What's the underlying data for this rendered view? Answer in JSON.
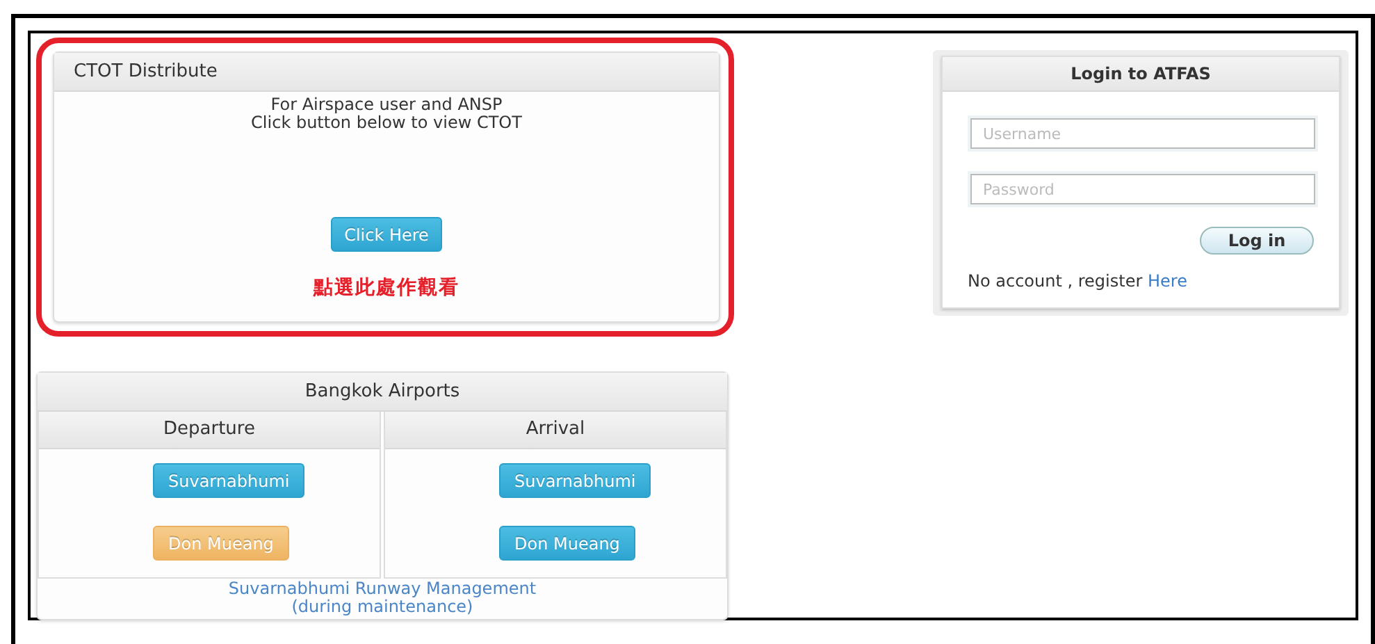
{
  "ctot_panel": {
    "title": "CTOT Distribute",
    "description": [
      "For Airspace user and ANSP",
      "Click button below to view CTOT"
    ],
    "button": "Click Here",
    "note": "點選此處作觀看"
  },
  "airports_panel": {
    "title": "Bangkok Airports",
    "columns": [
      {
        "heading": "Departure",
        "buttons": [
          {
            "label": "Suvarnabhumi",
            "kind": "info"
          },
          {
            "label": "Don Mueang",
            "kind": "warning"
          }
        ]
      },
      {
        "heading": "Arrival",
        "buttons": [
          {
            "label": "Suvarnabhumi",
            "kind": "info"
          },
          {
            "label": "Don Mueang",
            "kind": "info"
          }
        ]
      }
    ],
    "link": [
      "Suvarnabhumi Runway Management",
      "(during maintenance)"
    ]
  },
  "login_panel": {
    "title": "Login to ATFAS",
    "username": {
      "placeholder": "Username"
    },
    "password": {
      "placeholder": "Password"
    },
    "button": "Log in",
    "register_text": "No account , register",
    "register_link": "Here"
  }
}
